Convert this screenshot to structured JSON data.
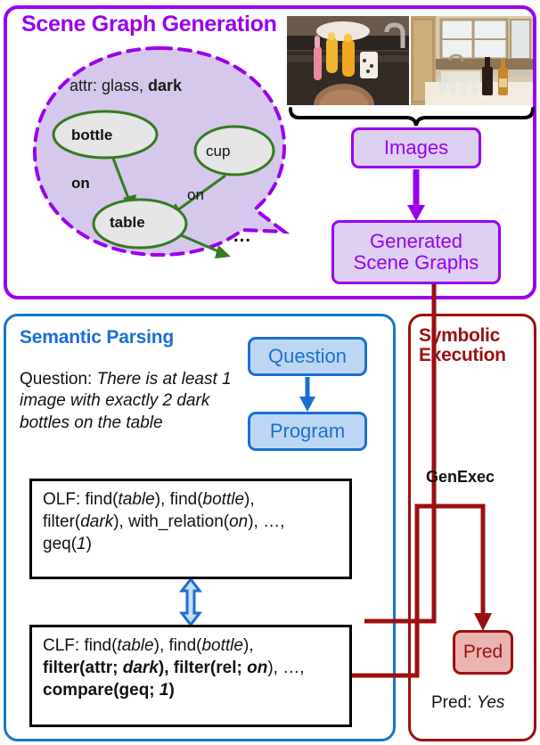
{
  "panels": {
    "scene_graph_generation": {
      "title": "Scene Graph Generation",
      "color": "#9900ee"
    },
    "semantic_parsing": {
      "title": "Semantic Parsing",
      "color": "#1a6fd0"
    },
    "symbolic_execution": {
      "title": "Symbolic Execution",
      "color": "#9b1010"
    }
  },
  "scene_graph": {
    "attr_prefix": "attr: glass, ",
    "attr_bold": "dark",
    "nodes": [
      {
        "id": "bottle",
        "label": "bottle"
      },
      {
        "id": "cup",
        "label": "cup"
      },
      {
        "id": "table",
        "label": "table"
      },
      {
        "id": "ellipsis",
        "label": "…"
      }
    ],
    "edges": [
      {
        "from": "bottle",
        "to": "table",
        "label": "on"
      },
      {
        "from": "cup",
        "to": "table",
        "label": "on"
      },
      {
        "from": "table",
        "to": "ellipsis",
        "label": ""
      }
    ],
    "edge_label_1": "on",
    "edge_label_2": "on",
    "ellipsis": "…"
  },
  "boxes": {
    "images": "Images",
    "generated_scene_graphs_line1": "Generated",
    "generated_scene_graphs_line2": "Scene Graphs",
    "question": "Question",
    "program": "Program",
    "pred": "Pred"
  },
  "question": {
    "label": "Question: ",
    "body": "There is at least 1 image with exactly 2 dark bottles on the table"
  },
  "olf": {
    "prefix": "OLF: ",
    "line1_a": "find(",
    "line1_arg1": "table",
    "line1_b": "), find(",
    "line1_arg2": "bottle",
    "line1_c": "),",
    "line2_a": "filter(",
    "line2_arg1": "dark",
    "line2_b": "), with_relation(",
    "line2_arg2": "on",
    "line2_c": "), …,",
    "line3_a": "geq(",
    "line3_arg1": "1",
    "line3_b": ")"
  },
  "clf": {
    "prefix": "CLF: ",
    "line1_a": "find(",
    "line1_arg1": "table",
    "line1_b": "), find(",
    "line1_arg2": "bottle",
    "line1_c": "),",
    "line2_a": "filter(attr; ",
    "line2_arg1": "dark",
    "line2_b": "), filter(rel; ",
    "line2_arg2": "on",
    "line2_c": "), …,",
    "line3_a": "compare(geq; ",
    "line3_arg1": "1",
    "line3_b": ")"
  },
  "symbolic": {
    "genexec": "GenExec",
    "pred_label": "Pred: ",
    "pred_value": "Yes"
  },
  "colors": {
    "purple": "#9900ee",
    "purple_fill": "#ddd0f0",
    "blue": "#1a6fd0",
    "blue_fill": "#bdd7f3",
    "red": "#9b1010",
    "red_fill": "#eab5b1",
    "green": "#357a21",
    "node_fill": "#e6e6e6",
    "black": "#000000"
  }
}
